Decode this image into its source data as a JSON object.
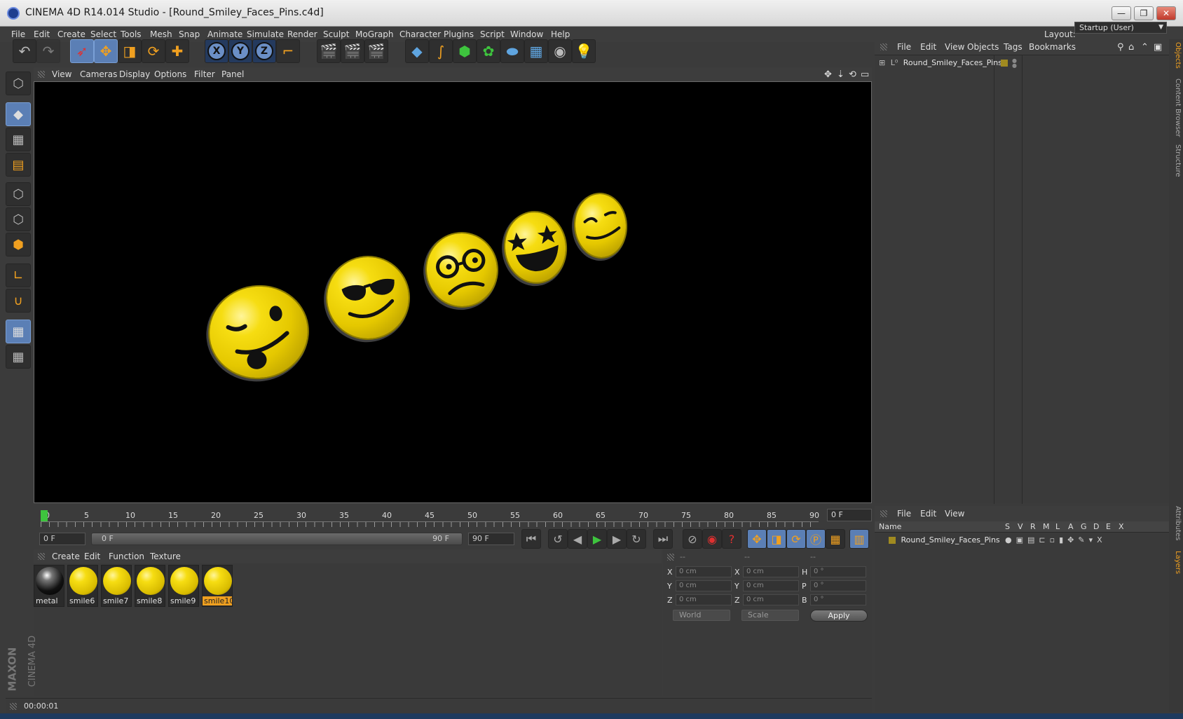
{
  "window": {
    "title": "CINEMA 4D R14.014 Studio - [Round_Smiley_Faces_Pins.c4d]",
    "minimize": "—",
    "maximize": "❐",
    "close": "✕"
  },
  "menubar": [
    "File",
    "Edit",
    "Create",
    "Select",
    "Tools",
    "Mesh",
    "Snap",
    "Animate",
    "Simulate",
    "Render",
    "Sculpt",
    "MoGraph",
    "Character",
    "Plugins",
    "Script",
    "Window",
    "Help"
  ],
  "layout": {
    "label": "Layout:",
    "value": "Startup (User)"
  },
  "viewport_menu": [
    "View",
    "Cameras",
    "Display",
    "Options",
    "Filter",
    "Panel"
  ],
  "timeline": {
    "ticks": [
      "0",
      "5",
      "10",
      "15",
      "20",
      "25",
      "30",
      "35",
      "40",
      "45",
      "50",
      "55",
      "60",
      "65",
      "70",
      "75",
      "80",
      "85",
      "90"
    ],
    "current_frame": "0 F",
    "start_field": "0 F",
    "range_start": "0 F",
    "range_end": "90 F",
    "end_field": "90 F"
  },
  "material_menu": [
    "Create",
    "Edit",
    "Function",
    "Texture"
  ],
  "materials": [
    {
      "name": "metal",
      "type": "metal"
    },
    {
      "name": "smile6",
      "type": "smiley"
    },
    {
      "name": "smile7",
      "type": "smiley"
    },
    {
      "name": "smile8",
      "type": "smiley"
    },
    {
      "name": "smile9",
      "type": "smiley"
    },
    {
      "name": "smile10",
      "type": "smiley",
      "selected": true
    }
  ],
  "coordinates": {
    "header": [
      "--",
      "--",
      "--"
    ],
    "rows": [
      {
        "pos_axis": "X",
        "pos": "0 cm",
        "size_axis": "X",
        "size": "0 cm",
        "rot_axis": "H",
        "rot": "0 °"
      },
      {
        "pos_axis": "Y",
        "pos": "0 cm",
        "size_axis": "Y",
        "size": "0 cm",
        "rot_axis": "P",
        "rot": "0 °"
      },
      {
        "pos_axis": "Z",
        "pos": "0 cm",
        "size_axis": "Z",
        "size": "0 cm",
        "rot_axis": "B",
        "rot": "0 °"
      }
    ],
    "space": "World",
    "mode": "Scale",
    "apply": "Apply"
  },
  "status": {
    "time": "00:00:01"
  },
  "object_manager": {
    "menu": [
      "File",
      "Edit",
      "View",
      "Objects",
      "Tags",
      "Bookmarks"
    ],
    "object": "Round_Smiley_Faces_Pins"
  },
  "layer_manager": {
    "menu": [
      "File",
      "Edit",
      "View"
    ],
    "columns": [
      "Name",
      "S",
      "V",
      "R",
      "M",
      "L",
      "A",
      "G",
      "D",
      "E",
      "X"
    ],
    "layer": "Round_Smiley_Faces_Pins"
  },
  "side_tabs": [
    "Objects",
    "Content Browser",
    "Structure",
    "Attributes",
    "Layers"
  ],
  "branding": {
    "maxon": "MAXON",
    "product": "CINEMA 4D"
  },
  "colors": {
    "accent": "#f0a020",
    "selection_blue": "#5b7fb5",
    "smiley_yellow": "#f2d40a",
    "playhead_green": "#3ec43e"
  }
}
